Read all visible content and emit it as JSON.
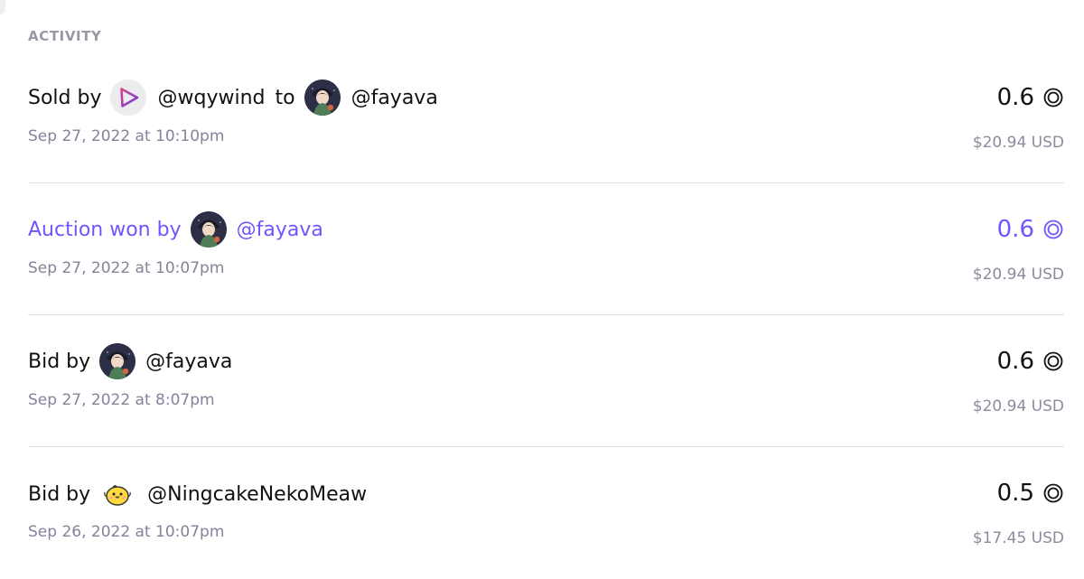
{
  "section_title": "ACTIVITY",
  "colors": {
    "accent": "#6e56ff",
    "text": "#111111",
    "muted": "#85829a",
    "divider": "#e0dfe6"
  },
  "activity": [
    {
      "prefix": "Sold by",
      "from_handle": "@wqywind",
      "from_avatar_icon": "triangle-play-logo-avatar",
      "connector": "to",
      "to_handle": "@fayava",
      "to_avatar_icon": "anime-character-avatar",
      "date": "Sep 27, 2022 at 10:10pm",
      "amount": "0.6",
      "currency_icon": "eth-icon",
      "usd": "$20.94 USD",
      "highlighted": false
    },
    {
      "prefix": "Auction won by",
      "handle": "@fayava",
      "avatar_icon": "anime-character-avatar",
      "date": "Sep 27, 2022 at 10:07pm",
      "amount": "0.6",
      "currency_icon": "eth-icon",
      "usd": "$20.94 USD",
      "highlighted": true
    },
    {
      "prefix": "Bid by",
      "handle": "@fayava",
      "avatar_icon": "anime-character-avatar",
      "date": "Sep 27, 2022 at 8:07pm",
      "amount": "0.6",
      "currency_icon": "eth-icon",
      "usd": "$20.94 USD",
      "highlighted": false
    },
    {
      "prefix": "Bid by",
      "handle": "@NingcakeNekoMeaw",
      "avatar_icon": "yellow-chick-avatar",
      "date": "Sep 26, 2022 at 10:07pm",
      "amount": "0.5",
      "currency_icon": "eth-icon",
      "usd": "$17.45 USD",
      "highlighted": false
    }
  ]
}
